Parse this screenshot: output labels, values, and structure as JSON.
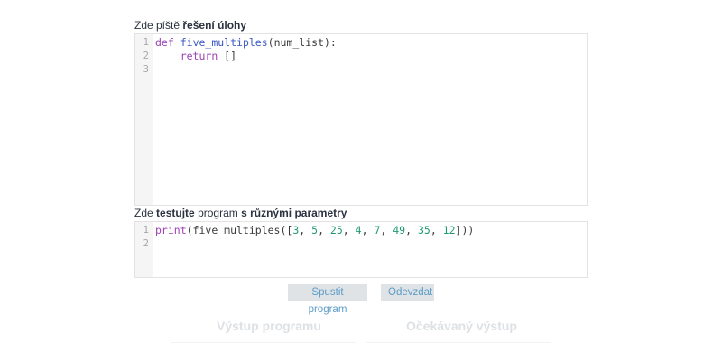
{
  "labels": {
    "solution": {
      "prefix": "Zde píště",
      "bold": "řešení úlohy"
    },
    "test": {
      "prefix": "Zde",
      "bold1": "testujte",
      "middle": "program",
      "bold2": "s různými parametry"
    }
  },
  "solution_editor": {
    "line_numbers": [
      "1",
      "2",
      "3"
    ],
    "lines": [
      {
        "kw": "def",
        "fn": "five_multiples",
        "rest": "(num_list):"
      },
      {
        "indent": "    ",
        "kw": "return",
        "rest": " []"
      },
      {
        "text": ""
      }
    ]
  },
  "test_editor": {
    "line_numbers": [
      "1",
      "2"
    ],
    "call": {
      "fn": "print",
      "open": "(five_multiples([",
      "close": "]))"
    },
    "args": [
      "3",
      "5",
      "25",
      "4",
      "7",
      "49",
      "35",
      "12"
    ],
    "separator": ", "
  },
  "buttons": {
    "run": "Spustit program",
    "submit": "Odevzdat"
  },
  "output": {
    "program_output": "Výstup programu",
    "expected_output": "Očekávaný výstup"
  },
  "colors": {
    "keyword": "#9c3fb3",
    "function": "#3a57c4",
    "number": "#1f9a6f",
    "button_text": "#5a9cc8"
  }
}
